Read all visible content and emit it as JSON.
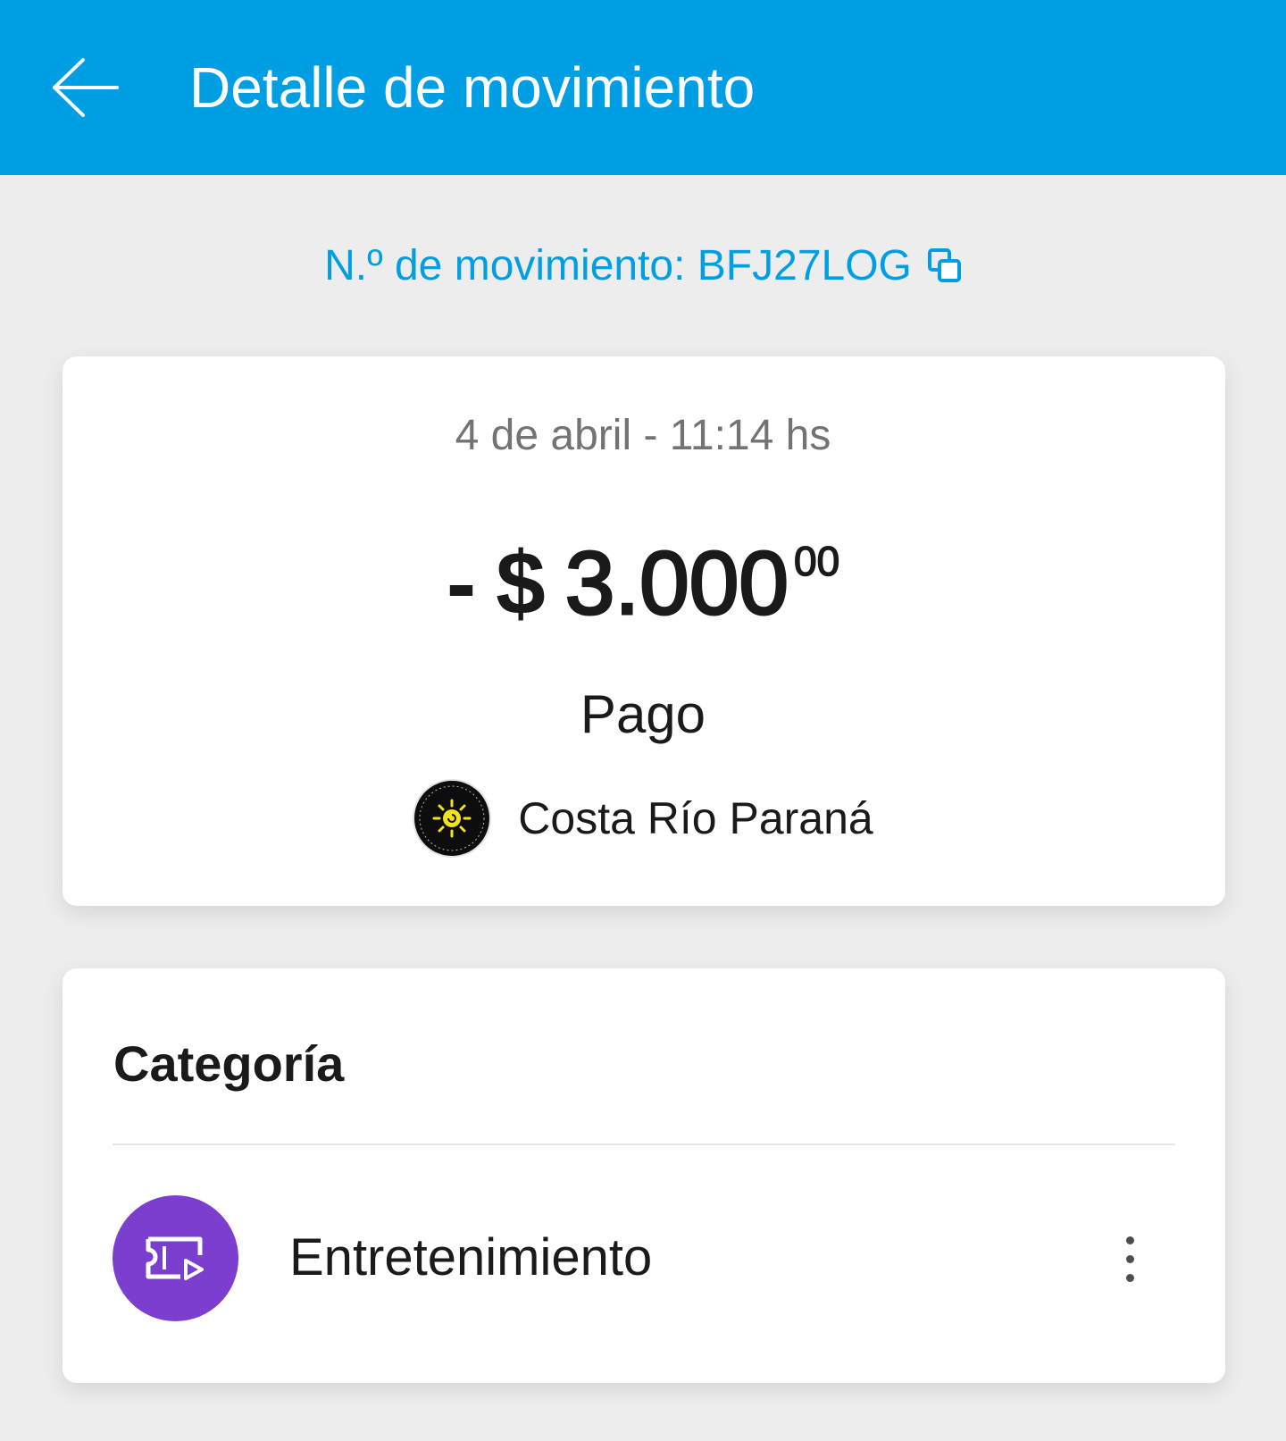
{
  "header": {
    "title": "Detalle de movimiento",
    "back_icon": "arrow-left-icon",
    "background_color": "#009ee3"
  },
  "movement": {
    "id_label": "N.º de movimiento: BFJ27LOG",
    "copy_icon": "copy-icon"
  },
  "summary": {
    "date": "4 de abril - 11:14 hs",
    "amount_sign": "-",
    "currency": "$",
    "amount_integer": "3.000",
    "amount_cents": "00",
    "type": "Pago",
    "merchant_name": "Costa Río Paraná",
    "merchant_logo_icon": "merchant-logo-sun"
  },
  "category_section": {
    "title": "Categoría",
    "category_label": "Entretenimiento",
    "category_icon": "ticket-icon",
    "category_color": "#7b3ecf",
    "more_icon": "more-vertical-icon"
  }
}
